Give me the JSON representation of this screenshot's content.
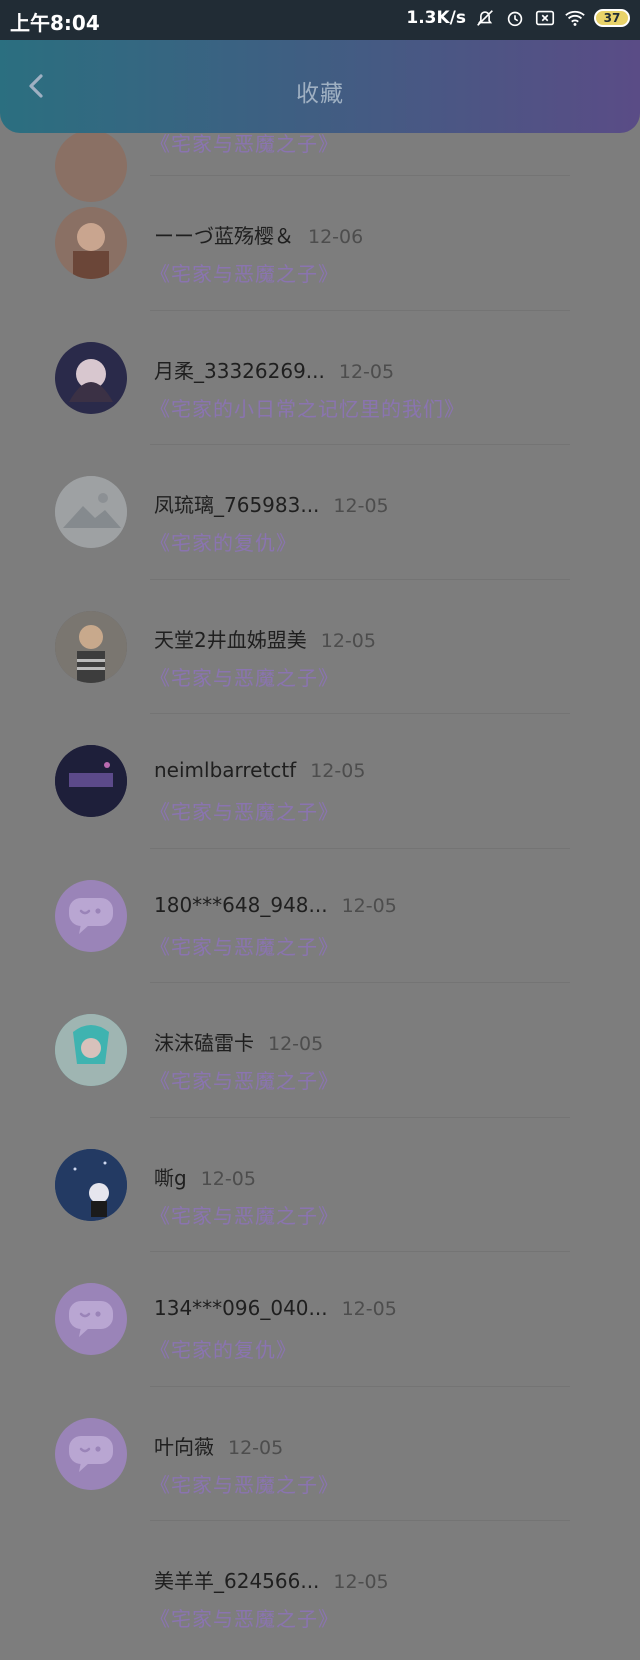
{
  "status_bar": {
    "time": "上午8:04",
    "net_speed": "1.3K/s",
    "battery": "37"
  },
  "header": {
    "title": "收藏",
    "back_icon": "chevron-left-icon"
  },
  "colors": {
    "header_gradient_start": "#2b6f80",
    "header_gradient_end": "#5a4c86",
    "book_title": "#8a74b0",
    "default_avatar": "#9a84b8"
  },
  "partial_row": {
    "book": "《宅家与恶魔之子》"
  },
  "items": [
    {
      "user": "ーーづ蓝殇樱＆",
      "date": "12-06",
      "book": "《宅家与恶魔之子》",
      "avatar": "warm"
    },
    {
      "user": "月柔_33326269...",
      "date": "12-05",
      "book": "《宅家的小日常之记忆里的我们》",
      "avatar": "dark"
    },
    {
      "user": "凤琉璃_765983...",
      "date": "12-05",
      "book": "《宅家的复仇》",
      "avatar": "mountain"
    },
    {
      "user": "天堂2井血姊盟美",
      "date": "12-05",
      "book": "《宅家与恶魔之子》",
      "avatar": "person"
    },
    {
      "user": "neimlbarretctf",
      "date": "12-05",
      "book": "《宅家与恶魔之子》",
      "avatar": "dark"
    },
    {
      "user": "180***648_948...",
      "date": "12-05",
      "book": "《宅家与恶魔之子》",
      "avatar": "default"
    },
    {
      "user": "沫沫磕雷卡",
      "date": "12-05",
      "book": "《宅家与恶魔之子》",
      "avatar": "teal"
    },
    {
      "user": "嘶g",
      "date": "12-05",
      "book": "《宅家与恶魔之子》",
      "avatar": "night"
    },
    {
      "user": "134***096_040...",
      "date": "12-05",
      "book": "《宅家的复仇》",
      "avatar": "default"
    },
    {
      "user": "叶向薇",
      "date": "12-05",
      "book": "《宅家与恶魔之子》",
      "avatar": "default"
    },
    {
      "user": "美羊羊_624566...",
      "date": "12-05",
      "book": "《宅家与恶魔之子》",
      "avatar": "none"
    }
  ]
}
